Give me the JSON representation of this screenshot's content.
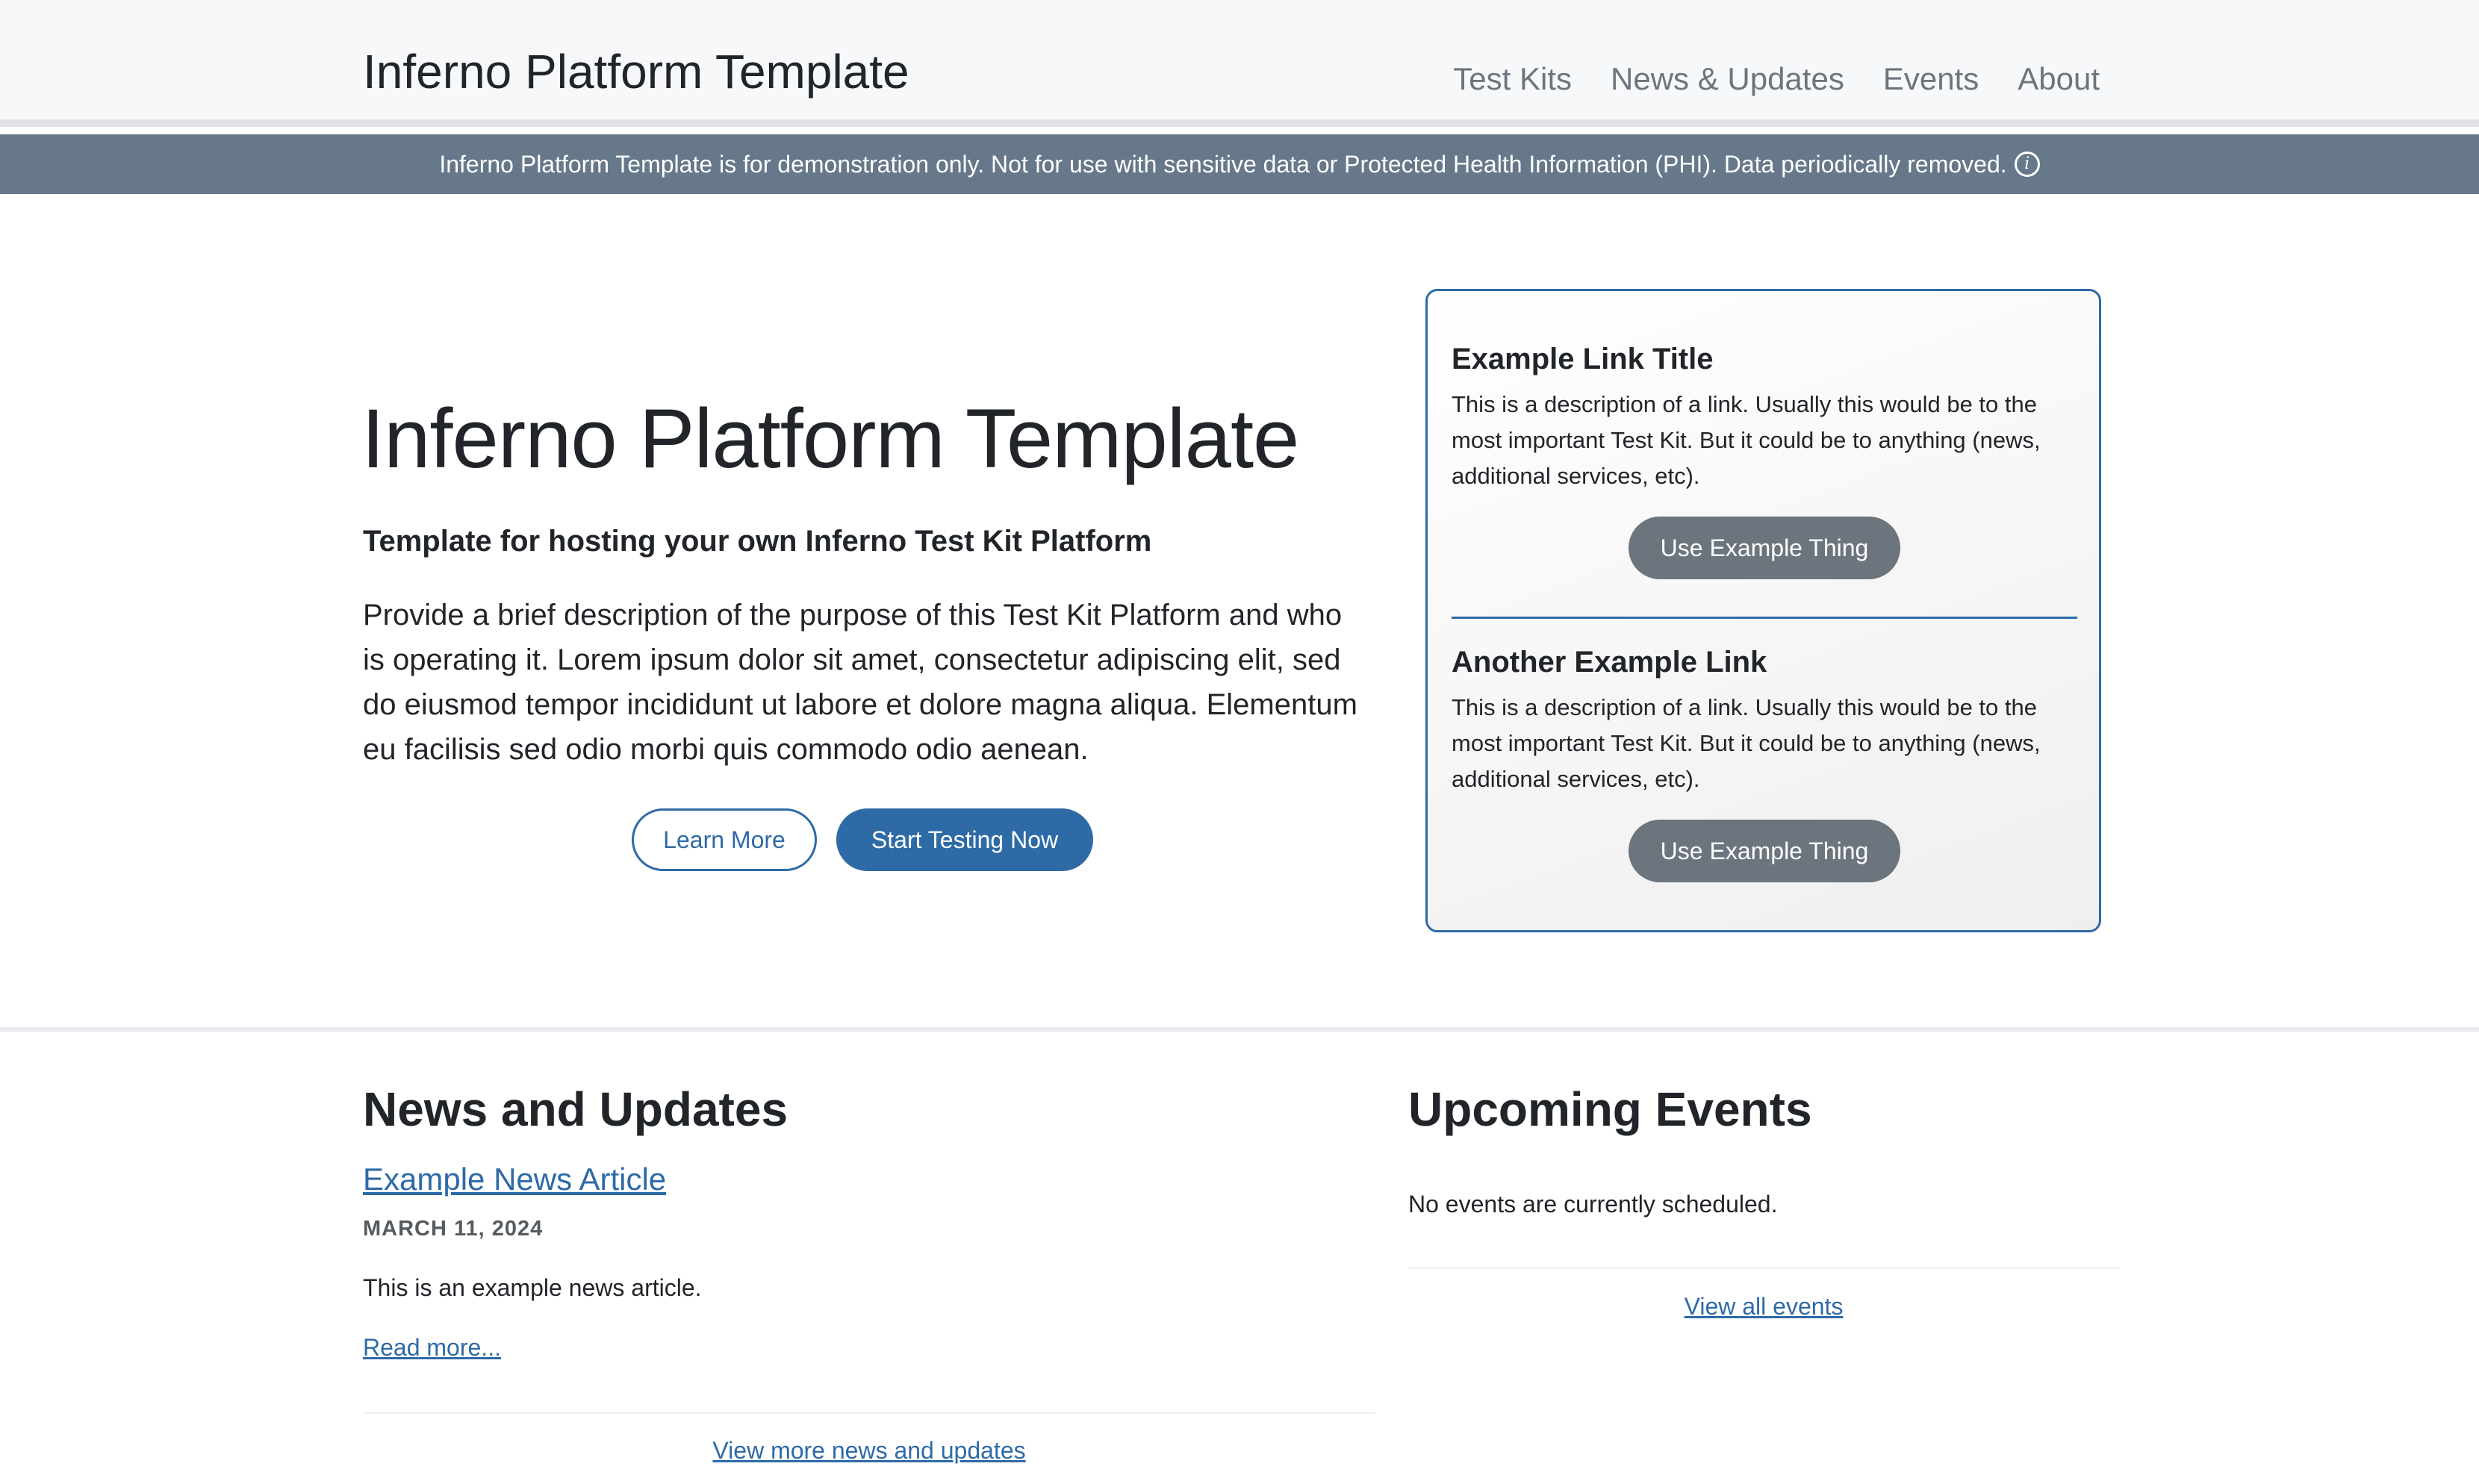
{
  "header": {
    "brand": "Inferno Platform Template",
    "nav": [
      {
        "label": "Test Kits"
      },
      {
        "label": "News & Updates"
      },
      {
        "label": "Events"
      },
      {
        "label": "About"
      }
    ]
  },
  "banner": {
    "text": "Inferno Platform Template is for demonstration only. Not for use with sensitive data or Protected Health Information (PHI). Data periodically removed.",
    "icon": "info-circle-icon",
    "icon_glyph": "i"
  },
  "hero": {
    "title": "Inferno Platform Template",
    "subtitle": "Template for hosting your own Inferno Test Kit Platform",
    "description": "Provide a brief description of the purpose of this Test Kit Platform and who is operating it. Lorem ipsum dolor sit amet, consectetur adipiscing elit, sed do eiusmod tempor incididunt ut labore et dolore magna aliqua. Elementum eu facilisis sed odio morbi quis commodo odio aenean.",
    "learn_more_label": "Learn More",
    "start_testing_label": "Start Testing Now"
  },
  "links_card": {
    "items": [
      {
        "title": "Example Link Title",
        "description": "This is a description of a link. Usually this would be to the most important Test Kit. But it could be to anything (news, additional services, etc).",
        "button_label": "Use Example Thing"
      },
      {
        "title": "Another Example Link",
        "description": "This is a description of a link. Usually this would be to the most important Test Kit. But it could be to anything (news, additional services, etc).",
        "button_label": "Use Example Thing"
      }
    ]
  },
  "news": {
    "heading": "News and Updates",
    "articles": [
      {
        "title": "Example News Article",
        "date": "MARCH 11, 2024",
        "summary": "This is an example news article.",
        "read_more_label": "Read more..."
      }
    ],
    "view_more_label": "View more news and updates"
  },
  "events": {
    "heading": "Upcoming Events",
    "empty_message": "No events are currently scheduled.",
    "view_all_label": "View all events"
  },
  "colors": {
    "primary": "#2e6aa6",
    "secondary": "#6c757d",
    "banner": "#66788a",
    "header_bg": "#f7f8fa"
  }
}
